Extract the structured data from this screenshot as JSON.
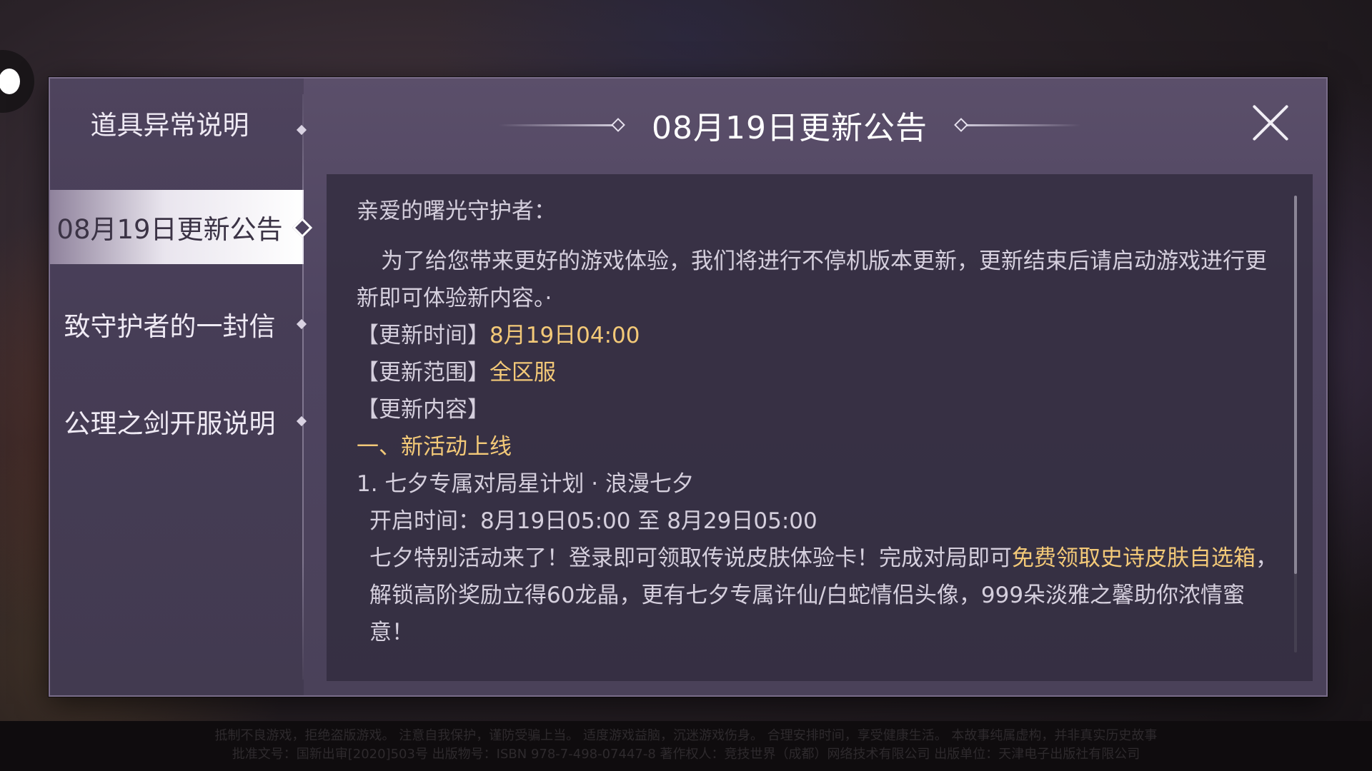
{
  "sidebar": {
    "items": [
      {
        "label": "道具异常说明",
        "active": false
      },
      {
        "label": "08月19日更新公告",
        "active": true
      },
      {
        "label": "致守护者的一封信",
        "active": false
      },
      {
        "label": "公理之剑开服说明",
        "active": false
      }
    ]
  },
  "header": {
    "title": "08月19日更新公告",
    "close_icon": "close-icon"
  },
  "content": {
    "greeting": "亲爱的曙光守护者：",
    "intro": "为了给您带来更好的游戏体验，我们将进行不停机版本更新，更新结束后请启动游戏进行更新即可体验新内容。·",
    "update_time_label": "【更新时间】",
    "update_time_value": "8月19日04:00",
    "update_scope_label": "【更新范围】",
    "update_scope_value": "全区服",
    "update_content_label": "【更新内容】",
    "section_title": "一、新活动上线",
    "item1_title": "1. 七夕专属对局星计划 · 浪漫七夕",
    "item1_time": "开启时间：8月19日05:00 至 8月29日05:00",
    "item1_desc_a": "七夕特别活动来了！登录即可领取传说皮肤体验卡！完成对局即可",
    "item1_desc_highlight": "免费领取史诗皮肤自选箱",
    "item1_desc_b": "，解锁高阶奖励立得60龙晶，更有七夕专属许仙/白蛇情侣头像，999朵淡雅之馨助你浓情蜜意！"
  },
  "colors": {
    "highlight": "#f3c978",
    "text": "#d5cfdd",
    "panel": "#4e4460"
  },
  "scroll": {
    "position": 0.0,
    "visible_fraction": 0.83
  },
  "footer": {
    "line1": "抵制不良游戏，拒绝盗版游戏。 注意自我保护，谨防受骗上当。 适度游戏益脑，沉迷游戏伤身。 合理安排时间，享受健康生活。 本故事纯属虚构，并非真实历史故事",
    "line2": "批准文号：国新出审[2020]503号 出版物号：ISBN 978-7-498-07447-8 著作权人：竞技世界（成都）网络技术有限公司 出版单位：天津电子出版社有限公司"
  }
}
